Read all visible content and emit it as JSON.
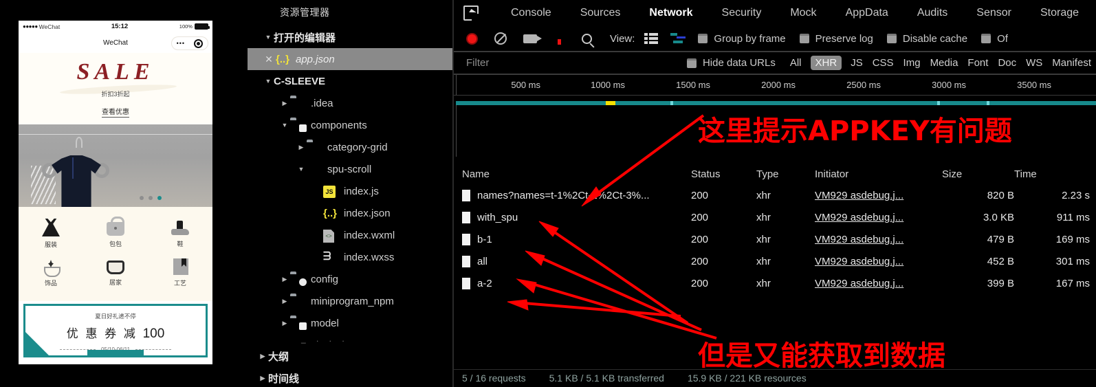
{
  "simulator": {
    "status_bar": {
      "carrier": "WeChat",
      "signal_dots": "●●●●●",
      "time": "15:12",
      "battery_pct": "100%"
    },
    "nav": {
      "title": "WeChat",
      "capsule_dots": "•••"
    },
    "banner": {
      "sale_word": "SALE",
      "subtitle": "折扣3折起",
      "link": "查看优惠"
    },
    "categories": [
      {
        "icon": "dress-icon",
        "label": "服装"
      },
      {
        "icon": "bag-icon",
        "label": "包包"
      },
      {
        "icon": "shoe-icon",
        "label": "鞋"
      },
      {
        "icon": "accessory-icon",
        "label": "饰品"
      },
      {
        "icon": "home-icon",
        "label": "居家"
      },
      {
        "icon": "craft-icon",
        "label": "工艺"
      }
    ],
    "coupon": {
      "top": "夏日好礼递不停",
      "main": "优 惠 券 减",
      "amount": "100",
      "date": "05/10-06/11"
    }
  },
  "explorer": {
    "title": "资源管理器",
    "open_editors": {
      "label": "打开的编辑器",
      "caret": "▼"
    },
    "open_file": {
      "close": "✕",
      "icon": "json-icon",
      "name": "app.json"
    },
    "project": {
      "label": "C-SLEEVE",
      "caret": "▼"
    },
    "tree": [
      {
        "indent": 1,
        "caret": "▶",
        "icon": "folder-icon",
        "name": ".idea"
      },
      {
        "indent": 1,
        "caret": "▼",
        "icon": "folder-components-icon",
        "name": "components"
      },
      {
        "indent": 2,
        "caret": "▶",
        "icon": "folder-icon",
        "name": "category-grid"
      },
      {
        "indent": 2,
        "caret": "▼",
        "icon": "folder-open-icon",
        "name": "spu-scroll"
      },
      {
        "indent": 3,
        "caret": "",
        "icon": "js-file-icon",
        "name": "index.js"
      },
      {
        "indent": 3,
        "caret": "",
        "icon": "json-file-icon",
        "name": "index.json"
      },
      {
        "indent": 3,
        "caret": "",
        "icon": "wxml-file-icon",
        "name": "index.wxml"
      },
      {
        "indent": 3,
        "caret": "",
        "icon": "wxss-file-icon",
        "name": "index.wxss"
      },
      {
        "indent": 1,
        "caret": "▶",
        "icon": "folder-config-icon",
        "name": "config"
      },
      {
        "indent": 1,
        "caret": "▶",
        "icon": "folder-icon",
        "name": "miniprogram_npm"
      },
      {
        "indent": 1,
        "caret": "▶",
        "icon": "folder-model-icon",
        "name": "model"
      }
    ],
    "footer_sections": [
      {
        "caret": "▶",
        "label": "大纲"
      },
      {
        "caret": "▶",
        "label": "时间线"
      }
    ]
  },
  "devtools": {
    "inspect_icon": "inspect-cursor-icon",
    "tabs": [
      {
        "label": "Console",
        "active": false
      },
      {
        "label": "Sources",
        "active": false
      },
      {
        "label": "Network",
        "active": true
      },
      {
        "label": "Security",
        "active": false
      },
      {
        "label": "Mock",
        "active": false
      },
      {
        "label": "AppData",
        "active": false
      },
      {
        "label": "Audits",
        "active": false
      },
      {
        "label": "Sensor",
        "active": false
      },
      {
        "label": "Storage",
        "active": false
      }
    ],
    "toolbar": {
      "record_icon": "record-button-icon",
      "clear_icon": "clear-icon",
      "camera_icon": "capture-screenshots-icon",
      "filter_icon": "filter-icon",
      "search_icon": "search-icon",
      "view_label": "View:",
      "list_view_icon": "list-view-icon",
      "waterfall_view_icon": "waterfall-view-icon",
      "checkboxes": [
        {
          "label": "Group by frame",
          "checked": false
        },
        {
          "label": "Preserve log",
          "checked": false
        },
        {
          "label": "Disable cache",
          "checked": false
        },
        {
          "label": "Of",
          "checked": false
        }
      ]
    },
    "filter_bar": {
      "placeholder": "Filter",
      "hide_data_urls": "Hide data URLs",
      "types": [
        {
          "label": "All",
          "active": false
        },
        {
          "label": "XHR",
          "active": true
        },
        {
          "label": "JS",
          "active": false
        },
        {
          "label": "CSS",
          "active": false
        },
        {
          "label": "Img",
          "active": false
        },
        {
          "label": "Media",
          "active": false
        },
        {
          "label": "Font",
          "active": false
        },
        {
          "label": "Doc",
          "active": false
        },
        {
          "label": "WS",
          "active": false
        },
        {
          "label": "Manifest",
          "active": false
        }
      ]
    },
    "timeline_ticks": [
      "500 ms",
      "1000 ms",
      "1500 ms",
      "2000 ms",
      "2500 ms",
      "3000 ms",
      "3500 ms"
    ],
    "table": {
      "columns": [
        "Name",
        "Status",
        "Type",
        "Initiator",
        "Size",
        "Time"
      ],
      "rows": [
        {
          "name": "names?names=t-1%2Ct-2%2Ct-3%...",
          "status": "200",
          "type": "xhr",
          "initiator": "VM929 asdebug.j...",
          "size": "820 B",
          "time": "2.23 s"
        },
        {
          "name": "with_spu",
          "status": "200",
          "type": "xhr",
          "initiator": "VM929 asdebug.j...",
          "size": "3.0 KB",
          "time": "911 ms"
        },
        {
          "name": "b-1",
          "status": "200",
          "type": "xhr",
          "initiator": "VM929 asdebug.j...",
          "size": "479 B",
          "time": "169 ms"
        },
        {
          "name": "all",
          "status": "200",
          "type": "xhr",
          "initiator": "VM929 asdebug.j...",
          "size": "452 B",
          "time": "301 ms"
        },
        {
          "name": "a-2",
          "status": "200",
          "type": "xhr",
          "initiator": "VM929 asdebug.j...",
          "size": "399 B",
          "time": "167 ms"
        }
      ]
    },
    "status_bar": {
      "requests": "5 / 16 requests",
      "transferred": "5.1 KB / 5.1 KB transferred",
      "resources": "15.9 KB / 221 KB resources"
    },
    "annotations": [
      {
        "text": "这里提示APPKEY有问题",
        "color": "#ff0000"
      },
      {
        "text": "但是又能获取到数据",
        "color": "#ff0000"
      }
    ]
  },
  "colors": {
    "accent_teal": "#17898b",
    "annotation_red": "#ff0000",
    "record_red": "#f01414",
    "selected_gray": "#8a8a8a"
  }
}
